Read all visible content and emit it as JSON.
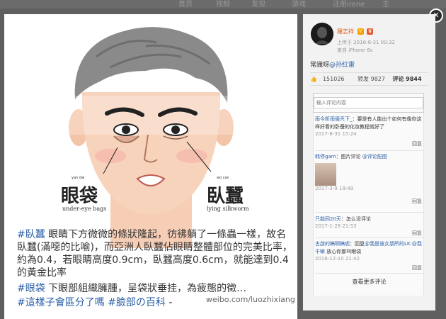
{
  "nav": {
    "items": [
      "首页",
      "视频",
      "发现",
      "游戏",
      "注册irene",
      "主"
    ]
  },
  "viewer": {
    "close_icon": "close-icon"
  },
  "image": {
    "labels": {
      "eyebag_zh": "眼袋",
      "eyebag_en": "under-eye bags",
      "eyebag_pinyin": "yan      dai",
      "silkworm_zh": "臥蠶",
      "silkworm_en": "lying silkworm",
      "silkworm_pinyin": "wo      can"
    },
    "caption_1": {
      "tag": "#臥蠶",
      "text": " 眼睛下方微微的條狀隆起，彷彿躺了一條蟲一樣，故名臥蠶(滿噁的比喻)，而亞洲人臥蠶佔眼睛整體部位的完美比率，約為0.4，若眼睛高度0.9cm，臥蠶高度0.6cm，就能達到0.4的黃金比率"
    },
    "caption_2": {
      "tag": "#眼袋",
      "text": " 下眼部組織臃腫，呈袋狀垂挂，為疲態的徵…"
    },
    "caption_3": {
      "tag1": "#這樣子會區分了嗎",
      "tag2": "#臉部の百科",
      "text": " -"
    },
    "watermark": "weibo.com/luozhixiang"
  },
  "post": {
    "username": "羅志祥",
    "upload_time": "上传于 2016-8-31 00:32",
    "source": "来自 iPhone 6s",
    "text": "常識呀",
    "mention": "@孙红雷",
    "likes": "151026",
    "reposts": "转发 9827",
    "comments": "评论 9844"
  },
  "comment_input": {
    "placeholder": "输入评论内容"
  },
  "comments": [
    {
      "user": "雨今昕雨僣兲下_",
      "text": "：要是有人能出个如何有像你这样好看的卧蚕的化妆教程就好了",
      "time": "2017-8-31 15:24",
      "reply": "回复"
    },
    {
      "user": "韩停gam",
      "text": "：图片评论 ",
      "link": "@评论配图",
      "time": "2017-3-9 19:49",
      "reply": "回复"
    },
    {
      "user": "只能同20天",
      "text": "：怎么没评论",
      "time": "2017-1-28 21:53",
      "reply": "回复"
    },
    {
      "user": "古啟的稿啊稿呢",
      "text": "：回复",
      "link": "@我是谁女朋所的LK:@我干嘛",
      "text2": " 放心你那叫眼袋",
      "time": "2016-12-10 21:42",
      "reply": "回复"
    }
  ],
  "more_comments": "查看更多评论"
}
